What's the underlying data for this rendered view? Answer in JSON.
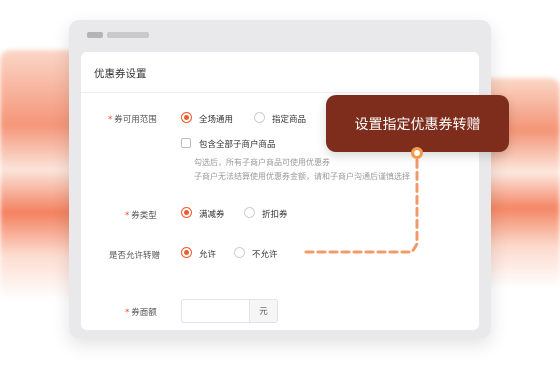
{
  "panel": {
    "title": "优惠券设置"
  },
  "form": {
    "scope": {
      "label": "券可用范围",
      "options": [
        "全场通用",
        "指定商品"
      ],
      "selected": "全场通用",
      "checkbox_label": "包含全部子商户商品",
      "help_line1": "勾选后，所有子商户商品可使用优惠券",
      "help_line2": "子商户无法结算使用优惠券金额，请和子商户沟通后谨慎选择"
    },
    "type": {
      "label": "券类型",
      "options": [
        "满减券",
        "折扣券"
      ],
      "selected": "满减券"
    },
    "transfer": {
      "label": "是否允许转赠",
      "options": [
        "允许",
        "不允许"
      ],
      "selected": "允许"
    },
    "amount": {
      "label": "券面额",
      "value": "",
      "unit": "元"
    }
  },
  "tooltip": {
    "text": "设置指定优惠券转赠"
  },
  "colors": {
    "accent": "#ef5b2e",
    "tooltip_bg": "#7e2d1c",
    "dashed_line": "#f39a6a"
  }
}
